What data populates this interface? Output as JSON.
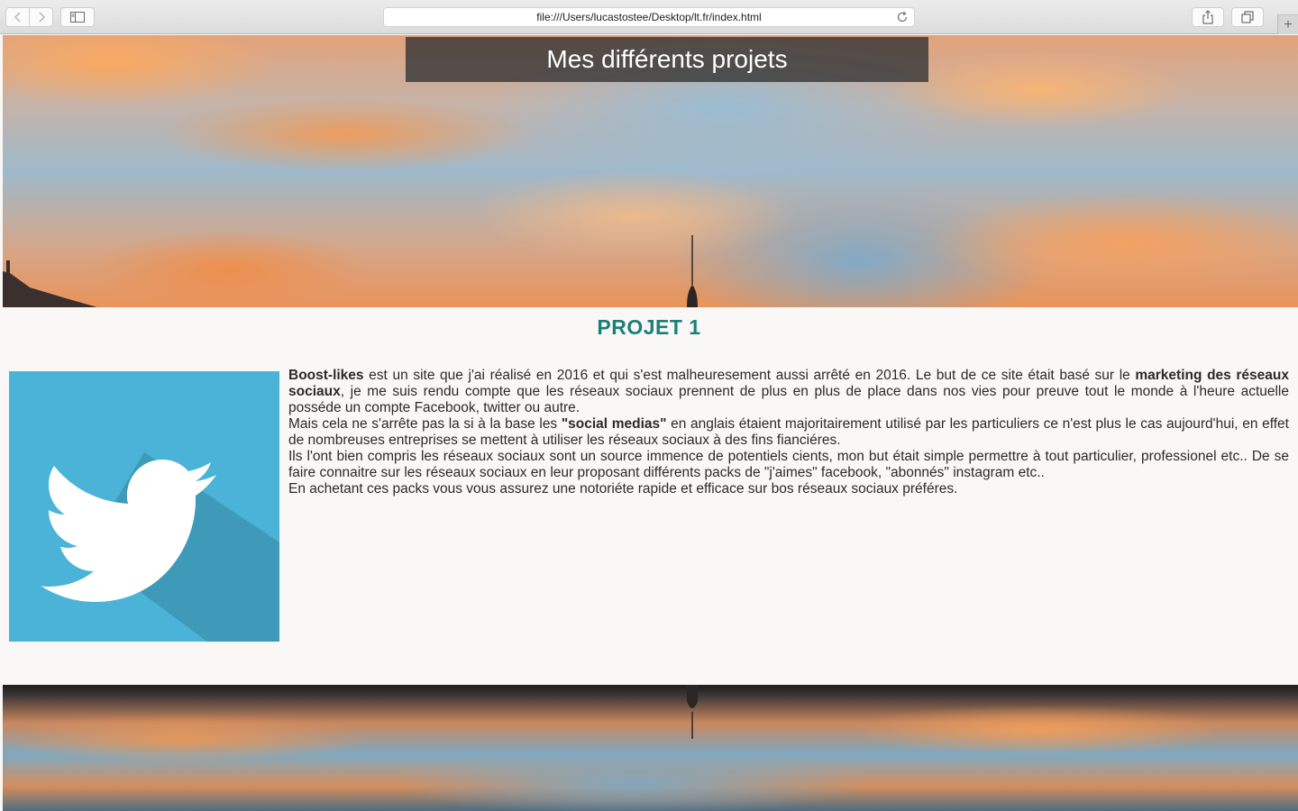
{
  "browser": {
    "url": "file:///Users/lucastostee/Desktop/lt.fr/index.html",
    "icons": [
      "back-icon",
      "forward-icon",
      "sidebar-icon",
      "reload-icon",
      "share-icon",
      "tabs-icon",
      "plus-icon"
    ]
  },
  "hero": {
    "title": "Mes différents projets"
  },
  "project": {
    "heading": "PROJET 1",
    "image_icon": "twitter-bird-icon",
    "image_bg": "#4ab3d7",
    "heading_color": "#1a8077",
    "paragraphs": {
      "p1_bold1": "Boost-likes",
      "p1_text1": " est un site que j'ai réalisé en 2016 et qui s'est malheuresement aussi arrêté en 2016. Le but de ce site était basé sur le ",
      "p1_bold2": "marketing des réseaux sociaux",
      "p1_text2": ", je me suis rendu compte que les réseaux sociaux prennent de plus en plus de place dans nos vies pour preuve tout le monde à l'heure actuelle posséde un compte Facebook, twitter ou autre.",
      "p2_text1": "Mais cela ne s'arrête pas la si à la base les ",
      "p2_bold": "\"social medias\"",
      "p2_text2": " en anglais étaient majoritairement utilisé par les particuliers ce n'est plus le cas aujourd'hui, en effet de nombreuses entreprises se mettent à utiliser les réseaux sociaux à des fins fianciéres.",
      "p3": "Ils l'ont bien compris les réseaux sociaux sont un source immence de potentiels cients, mon but était simple permettre à tout particulier, professionel etc.. De se faire connaitre sur les réseaux sociaux en leur proposant différents packs de \"j'aimes\" facebook, \"abonnés\" instagram etc..",
      "p4": "En achetant ces packs vous vous assurez une notoriéte rapide et efficace sur bos réseaux sociaux préféres."
    }
  }
}
